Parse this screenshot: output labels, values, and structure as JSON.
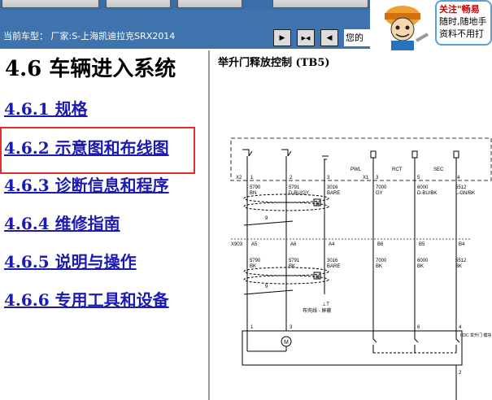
{
  "toolbar": {
    "buttons": [
      "",
      "",
      "",
      ""
    ]
  },
  "car_bar": {
    "label": "当前车型： 厂家:S-上海凯迪拉克SRX2014",
    "trailing_text": "您的",
    "nav_buttons": [
      {
        "icon": "play-right-icon",
        "glyph": "▶"
      },
      {
        "icon": "fast-forward-icon",
        "glyph": "▶◀"
      },
      {
        "icon": "play-left-icon",
        "glyph": "◀"
      }
    ]
  },
  "ad": {
    "line1": "关注\"畅易",
    "line2": "随时,随地手",
    "line3": "资料不用打"
  },
  "nav": {
    "chapter_title": "4.6 车辆进入系统",
    "items": [
      {
        "label": "4.6.1 规格"
      },
      {
        "label": "4.6.2 示意图和布线图",
        "selected": true
      },
      {
        "label": "4.6.3 诊断信息和程序"
      },
      {
        "label": "4.6.4 维修指南"
      },
      {
        "label": "4.6.5 说明与操作"
      },
      {
        "label": "4.6.6 专用工具和设备"
      }
    ]
  },
  "diagram": {
    "title": "举升门释放控制 (TB5)",
    "connector_top": "X2",
    "connector_mid": "X903",
    "connector_x1": "X1",
    "signals": [
      "PWL",
      "RCT",
      "SEC"
    ],
    "top_pins": [
      "1",
      "2",
      "3",
      "3",
      "5",
      "4"
    ],
    "mid_pins": [
      "A5",
      "A6",
      "A4",
      "B6",
      "B5",
      "B4"
    ],
    "bottom_pins": [
      "1",
      "3",
      "",
      "",
      "6",
      "4"
    ],
    "wires_top": [
      {
        "circuit": "5790",
        "color": "BN"
      },
      {
        "circuit": "5791",
        "color": "D-BU/GY"
      },
      {
        "circuit": "3016",
        "color": "BARE"
      },
      {
        "circuit": "7000",
        "color": "GY"
      },
      {
        "circuit": "6000",
        "color": "D-BU/BK"
      },
      {
        "circuit": "5512",
        "color": "L-GN/BK"
      }
    ],
    "wires_mid": [
      {
        "circuit": "5790",
        "color": "BK"
      },
      {
        "circuit": "5791",
        "color": "BK"
      },
      {
        "circuit": "3016",
        "color": "BARE"
      },
      {
        "circuit": "7000",
        "color": "BK"
      },
      {
        "circuit": "6000",
        "color": "BK"
      },
      {
        "circuit": "5512",
        "color": "BK"
      }
    ],
    "twist_label": "9",
    "ground_note": "布壳线 - 屏蔽",
    "ground_symbol": "⊥T",
    "motor_label": "M",
    "device_label": "I23C 举升门 模块",
    "bottom_pin": "2"
  },
  "colors": {
    "nav_link": "#1b1bb3",
    "bar_blue": "#3f73ad",
    "highlight": "#e03030"
  }
}
